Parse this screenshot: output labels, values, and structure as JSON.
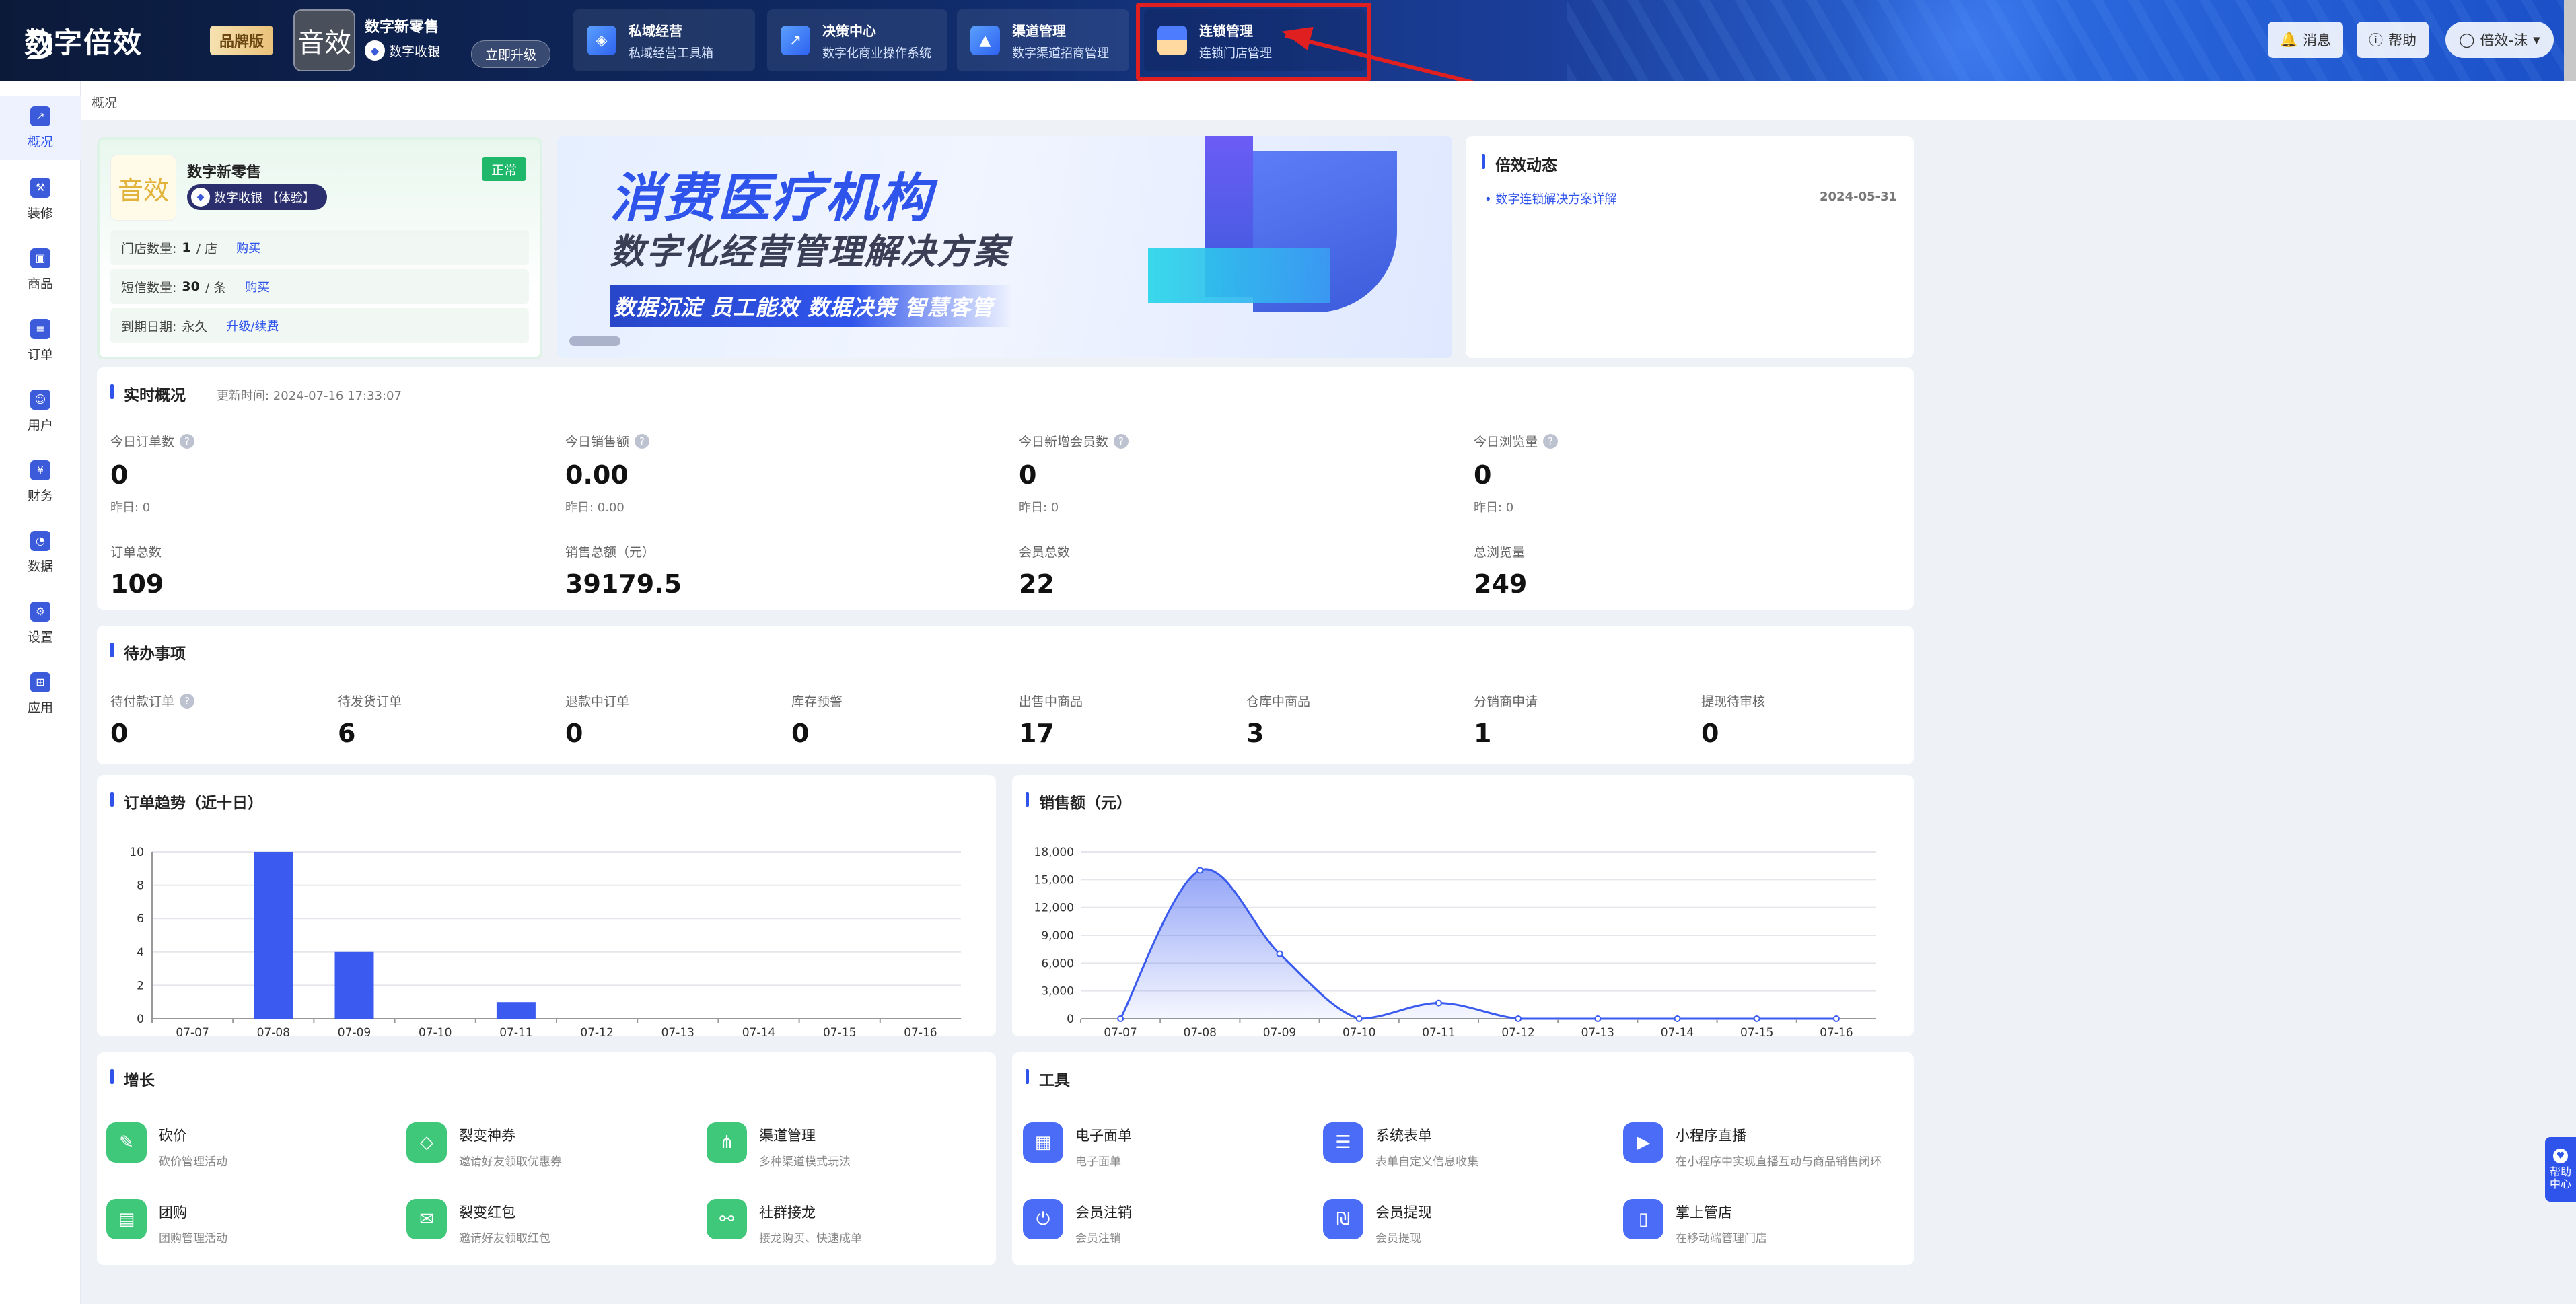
{
  "topbar": {
    "logo_text": "数字倍效",
    "brand_badge": "品牌版",
    "store_avatar_text": "音效",
    "store_name": "数字新零售",
    "store_tag": "数字收银",
    "upgrade_label": "立即升级",
    "modules": [
      {
        "title": "私域经营",
        "sub": "私域经营工具箱",
        "icon": "private-domain-icon"
      },
      {
        "title": "决策中心",
        "sub": "数字化商业操作系统",
        "icon": "decision-icon"
      },
      {
        "title": "渠道管理",
        "sub": "数字渠道招商管理",
        "icon": "channel-icon"
      },
      {
        "title": "连锁管理",
        "sub": "连锁门店管理",
        "icon": "chain-store-icon"
      }
    ],
    "message_label": "消息",
    "help_label": "帮助",
    "user_label": "倍效-沫"
  },
  "sidebar": {
    "items": [
      {
        "label": "概况",
        "icon": "overview-icon"
      },
      {
        "label": "装修",
        "icon": "decorate-icon"
      },
      {
        "label": "商品",
        "icon": "goods-icon"
      },
      {
        "label": "订单",
        "icon": "order-icon"
      },
      {
        "label": "用户",
        "icon": "user-icon"
      },
      {
        "label": "财务",
        "icon": "finance-icon"
      },
      {
        "label": "数据",
        "icon": "data-icon"
      },
      {
        "label": "设置",
        "icon": "settings-icon"
      },
      {
        "label": "应用",
        "icon": "apps-icon"
      }
    ]
  },
  "breadcrumb": "概况",
  "store_card": {
    "logo_text": "音效",
    "name": "数字新零售",
    "tag": "数字收银 【体验】",
    "status": "正常",
    "store_count_label": "门店数量:",
    "store_count_value": "1",
    "store_count_unit": "/ 店",
    "sms_label": "短信数量:",
    "sms_value": "30",
    "sms_unit": "/ 条",
    "expire_label": "到期日期:",
    "expire_value": "永久",
    "buy_label": "购买",
    "renew_label": "升级/续费"
  },
  "banner": {
    "title": "消费医疗机构",
    "subtitle": "数字化经营管理解决方案",
    "slogan": "数据沉淀  员工能效  数据决策  智慧客管"
  },
  "dynamics": {
    "title": "倍效动态",
    "item": "数字连锁解决方案详解",
    "date": "2024-05-31"
  },
  "realtime": {
    "title": "实时概况",
    "updated": "更新时间: 2024-07-16 17:33:07",
    "today": [
      {
        "label": "今日订单数",
        "value": "0",
        "yesterday": "昨日: 0"
      },
      {
        "label": "今日销售额",
        "value": "0.00",
        "yesterday": "昨日: 0.00"
      },
      {
        "label": "今日新增会员数",
        "value": "0",
        "yesterday": "昨日: 0"
      },
      {
        "label": "今日浏览量",
        "value": "0",
        "yesterday": "昨日: 0"
      }
    ],
    "totals": [
      {
        "label": "订单总数",
        "value": "109"
      },
      {
        "label": "销售总额（元）",
        "value": "39179.5"
      },
      {
        "label": "会员总数",
        "value": "22"
      },
      {
        "label": "总浏览量",
        "value": "249"
      }
    ]
  },
  "todo": {
    "title": "待办事项",
    "items": [
      {
        "label": "待付款订单",
        "value": "0"
      },
      {
        "label": "待发货订单",
        "value": "6"
      },
      {
        "label": "退款中订单",
        "value": "0"
      },
      {
        "label": "库存预警",
        "value": "0"
      },
      {
        "label": "出售中商品",
        "value": "17"
      },
      {
        "label": "仓库中商品",
        "value": "3"
      },
      {
        "label": "分销商申请",
        "value": "1"
      },
      {
        "label": "提现待审核",
        "value": "0"
      }
    ]
  },
  "chart_data": [
    {
      "type": "bar",
      "title": "订单趋势（近十日）",
      "categories": [
        "07-07",
        "07-08",
        "07-09",
        "07-10",
        "07-11",
        "07-12",
        "07-13",
        "07-14",
        "07-15",
        "07-16"
      ],
      "values": [
        0,
        10,
        4,
        0,
        1,
        0,
        0,
        0,
        0,
        0
      ],
      "ylim": [
        0,
        10
      ],
      "yticks": [
        0,
        2,
        4,
        6,
        8,
        10
      ],
      "grid": true,
      "color": "#3b5bf0"
    },
    {
      "type": "area",
      "title": "销售额（元）",
      "categories": [
        "07-07",
        "07-08",
        "07-09",
        "07-10",
        "07-11",
        "07-12",
        "07-13",
        "07-14",
        "07-15",
        "07-16"
      ],
      "values": [
        0,
        16000,
        7000,
        0,
        1700,
        0,
        0,
        0,
        0,
        0
      ],
      "ylim": [
        0,
        18000
      ],
      "yticks": [
        "0",
        "3,000",
        "6,000",
        "9,000",
        "12,000",
        "15,000",
        "18,000"
      ],
      "grid": true,
      "color": "#3b5bf0"
    }
  ],
  "growth": {
    "title": "增长",
    "items": [
      {
        "title": "砍价",
        "sub": "砍价管理活动",
        "icon": "bargain-icon"
      },
      {
        "title": "裂变神券",
        "sub": "邀请好友领取优惠券",
        "icon": "coupon-icon"
      },
      {
        "title": "渠道管理",
        "sub": "多种渠道模式玩法",
        "icon": "channel-tree-icon"
      },
      {
        "title": "团购",
        "sub": "团购管理活动",
        "icon": "group-buy-icon"
      },
      {
        "title": "裂变红包",
        "sub": "邀请好友领取红包",
        "icon": "red-packet-icon"
      },
      {
        "title": "社群接龙",
        "sub": "接龙购买、快速成单",
        "icon": "community-icon"
      }
    ]
  },
  "tools": {
    "title": "工具",
    "items": [
      {
        "title": "电子面单",
        "sub": "电子面单",
        "icon": "waybill-icon"
      },
      {
        "title": "系统表单",
        "sub": "表单自定义信息收集",
        "icon": "form-icon"
      },
      {
        "title": "小程序直播",
        "sub": "在小程序中实现直播互动与商品销售闭环",
        "icon": "live-icon"
      },
      {
        "title": "会员注销",
        "sub": "会员注销",
        "icon": "member-cancel-icon"
      },
      {
        "title": "会员提现",
        "sub": "会员提现",
        "icon": "withdraw-icon"
      },
      {
        "title": "掌上管店",
        "sub": "在移动端管理门店",
        "icon": "mobile-store-icon"
      }
    ]
  },
  "help_float": "帮助中心"
}
